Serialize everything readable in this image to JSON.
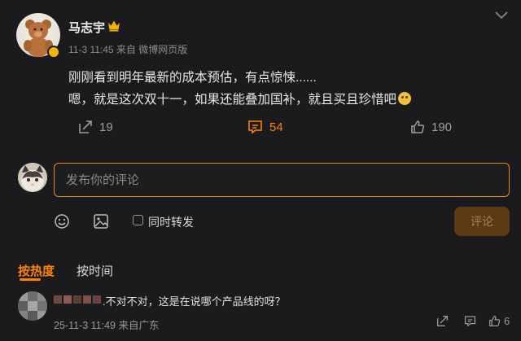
{
  "post": {
    "author": "马志宇",
    "meta": "11-3 11:45 来自 微博网页版",
    "lines": [
      "刚刚看到明年最新的成本预估，有点惊悚......",
      "嗯，就是这次双十一，如果还能叠加国补，就且买且珍惜吧"
    ],
    "repost_count": "19",
    "comment_count": "54",
    "like_count": "190"
  },
  "composer": {
    "placeholder": "发布你的评论",
    "repost_label": "同时转发",
    "submit_label": "评论"
  },
  "sort_tabs": {
    "hot": "按热度",
    "time": "按时间"
  },
  "reply": {
    "text": ".不对不对，这是在说哪个产品线的呀？",
    "meta": "25-11-3 11:49 来自广东",
    "like_count": "6"
  },
  "colors": {
    "accent": "#ff8200",
    "background": "#1b1b1d"
  },
  "icons": [
    "crown-icon",
    "more-icon",
    "repost-icon",
    "comment-icon",
    "like-icon",
    "emoji-icon",
    "image-icon",
    "share-icon",
    "reply-icon"
  ]
}
